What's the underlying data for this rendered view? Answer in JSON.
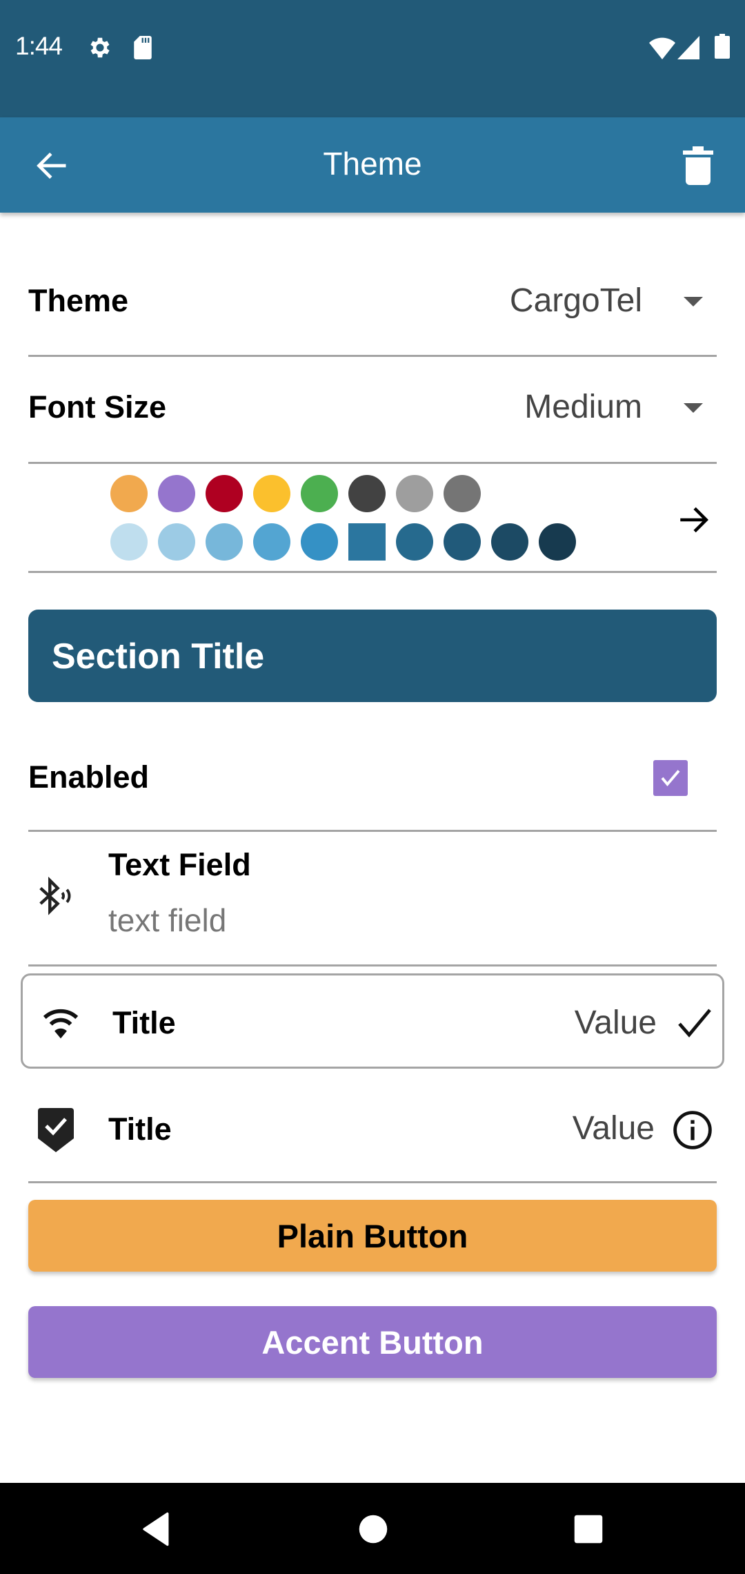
{
  "status_bar": {
    "time": "1:44",
    "left_icons": [
      "gear-icon",
      "sd-card-icon"
    ],
    "right_icons": [
      "wifi-icon",
      "signal-icon",
      "battery-icon"
    ]
  },
  "app_bar": {
    "title": "Theme",
    "back_icon": "arrow-left-icon",
    "action_icon": "trash-icon"
  },
  "settings": {
    "theme": {
      "label": "Theme",
      "value": "CargoTel"
    },
    "font_size": {
      "label": "Font Size",
      "value": "Medium"
    }
  },
  "palette": {
    "row1": [
      "#f1a94e",
      "#9575cd",
      "#af0021",
      "#fbc02d",
      "#4caf50",
      "#424242",
      "#9e9e9e",
      "#757575"
    ],
    "row2": [
      "#bfdeee",
      "#9ccbe5",
      "#77b7da",
      "#53a5d2",
      "#3591c5",
      "#2b769f",
      "#266a8e",
      "#215a7a",
      "#1c4a64",
      "#173a4f"
    ],
    "selected_row": 2,
    "selected_index": 5,
    "arrow_icon": "arrow-right-icon"
  },
  "section": {
    "title": "Section Title",
    "color": "#225a78"
  },
  "enabled": {
    "label": "Enabled",
    "checked": true,
    "color": "#9575cd"
  },
  "text_field": {
    "icon": "bluetooth-searching-icon",
    "title": "Text Field",
    "value": "text field"
  },
  "card_row": {
    "icon": "wifi-icon",
    "title": "Title",
    "value": "Value",
    "trailing_icon": "check-icon"
  },
  "info_row": {
    "icon": "shield-check-icon",
    "title": "Title",
    "value": "Value",
    "trailing_icon": "info-icon"
  },
  "buttons": {
    "plain": {
      "label": "Plain Button",
      "color": "#f1a94e"
    },
    "accent": {
      "label": "Accent Button",
      "color": "#9575cd"
    }
  },
  "nav_bar": [
    "back-triangle-icon",
    "home-circle-icon",
    "recents-square-icon"
  ]
}
